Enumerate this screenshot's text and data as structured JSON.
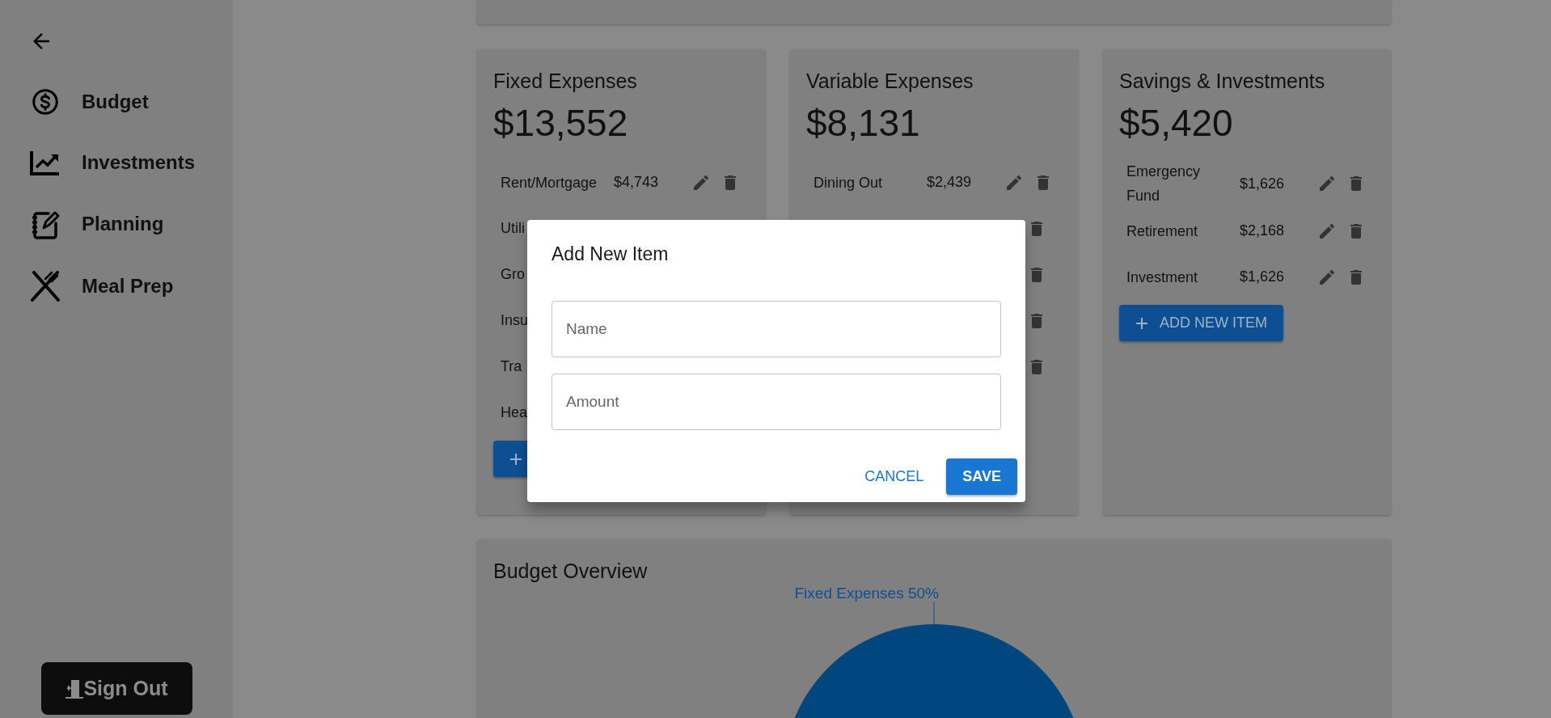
{
  "sidebar": {
    "items": [
      {
        "label": "Budget"
      },
      {
        "label": "Investments"
      },
      {
        "label": "Planning"
      },
      {
        "label": "Meal Prep"
      }
    ],
    "sign_out": "Sign Out"
  },
  "cards": [
    {
      "title": "Fixed Expenses",
      "total": "$13,552",
      "items": [
        {
          "kind": "full",
          "name": "Rent/Mortgage",
          "amount": "$4,743"
        },
        {
          "kind": "covered",
          "name": "Utili"
        },
        {
          "kind": "covered",
          "name": "Gro"
        },
        {
          "kind": "covered",
          "name": "Insu"
        },
        {
          "kind": "covered",
          "name": "Tra"
        },
        {
          "kind": "covered",
          "name": "Hea"
        }
      ],
      "add_button": {
        "kind": "covered"
      }
    },
    {
      "title": "Variable Expenses",
      "total": "$8,131",
      "items": [
        {
          "kind": "full",
          "name": "Dining Out",
          "amount": "$2,439"
        },
        {
          "kind": "hidden"
        },
        {
          "kind": "hidden"
        },
        {
          "kind": "hidden"
        },
        {
          "kind": "hidden"
        }
      ]
    },
    {
      "title": "Savings & Investments",
      "total": "$5,420",
      "items": [
        {
          "kind": "full",
          "name": "Emergency Fund",
          "amount": "$1,626"
        },
        {
          "kind": "full",
          "name": "Retirement",
          "amount": "$2,168"
        },
        {
          "kind": "full",
          "name": "Investment",
          "amount": "$1,626"
        }
      ],
      "add_button": {
        "kind": "full",
        "label": "ADD NEW ITEM"
      }
    }
  ],
  "overview": {
    "title": "Budget Overview",
    "chart_data": {
      "type": "pie",
      "categories": [
        "Fixed Expenses"
      ],
      "values": [
        50
      ],
      "value_labels": [
        "50%"
      ]
    }
  },
  "dialog": {
    "title": "Add New Item",
    "fields": [
      {
        "placeholder": "Name"
      },
      {
        "placeholder": "Amount"
      }
    ],
    "buttons": [
      {
        "kind": "text",
        "label": "CANCEL"
      },
      {
        "kind": "contained",
        "label": "SAVE"
      }
    ]
  }
}
